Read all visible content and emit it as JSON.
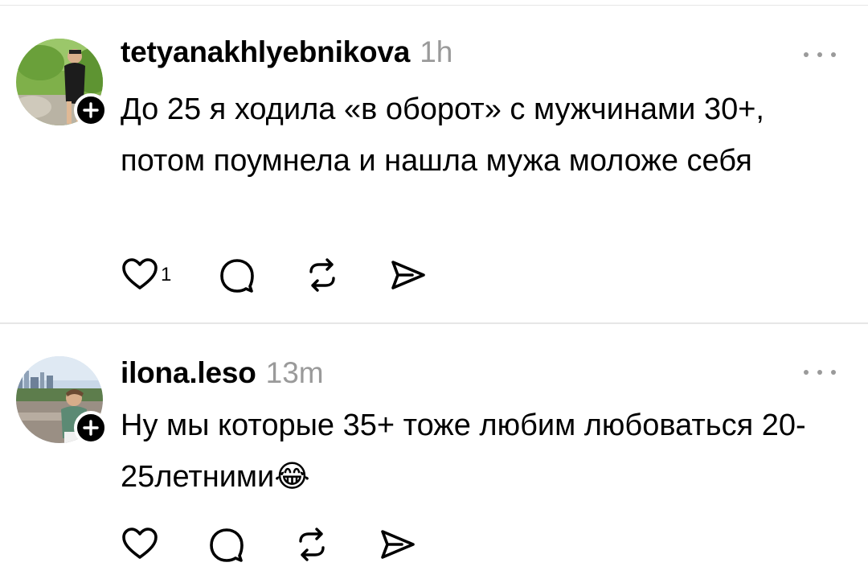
{
  "posts": [
    {
      "username": "tetyanakhlyebnikova",
      "time": "1h",
      "text": "До 25 я ходила «в оборот» с  мужчинами 30+, потом поумнела и нашла  мужа моложе себя",
      "likes": "1"
    },
    {
      "username": "ilona.leso",
      "time": "13m",
      "text": "Ну мы которые 35+ тоже любим любоваться 20-25летними😂",
      "likes": ""
    }
  ],
  "icons": {
    "like": "heart-icon",
    "reply": "comment-icon",
    "repost": "repost-icon",
    "share": "send-icon",
    "more": "more-icon",
    "follow": "plus-icon"
  },
  "colors": {
    "text": "#000000",
    "secondary": "#9a9a9a",
    "divider": "#e6e6e6"
  }
}
